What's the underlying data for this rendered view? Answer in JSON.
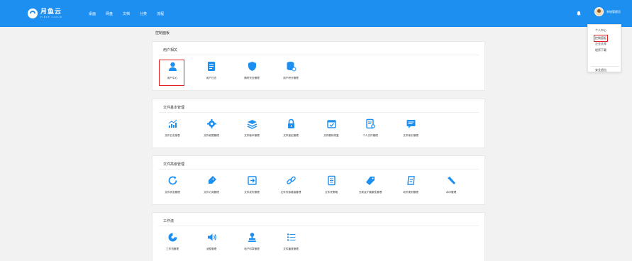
{
  "header": {
    "logo_name": "月鱼云",
    "logo_sub": "PIKKE CLOUD",
    "nav": [
      "桌面",
      "网盘",
      "文档",
      "分类",
      "流程"
    ],
    "user_name": "系统管理员"
  },
  "dropdown": {
    "items": [
      "个人中心",
      "控制面板",
      "企业文库",
      "程序下载",
      "安全退出"
    ],
    "selected": "控制面板"
  },
  "page_title": "控制面板",
  "sections": [
    {
      "title": "用户相关",
      "items": [
        "用户中心",
        "用户日志",
        "随时安全管理",
        "用户积分管理"
      ]
    },
    {
      "title": "文件基本管理",
      "items": [
        "文件日志报表",
        "文件权限管理",
        "文件版本管理",
        "文件锁定管理",
        "文件删除恢复",
        "个人文件管理",
        "文件索引管理"
      ]
    },
    {
      "title": "文件高级管理",
      "items": [
        "文件状态管理",
        "文件订阅管理",
        "文件发布管理",
        "文件外部链接管理",
        "文件夹策略",
        "分类及扩展属性管理",
        "动作规则管理",
        "水印管理"
      ]
    },
    {
      "title": "工作流",
      "items": [
        "工作流管理",
        "消息管理",
        "电子印章管理",
        "文件播放管理"
      ]
    }
  ],
  "colors": {
    "topbar": "#1d8ff0",
    "icon": "#1d8ff0",
    "highlight": "#e02020"
  }
}
